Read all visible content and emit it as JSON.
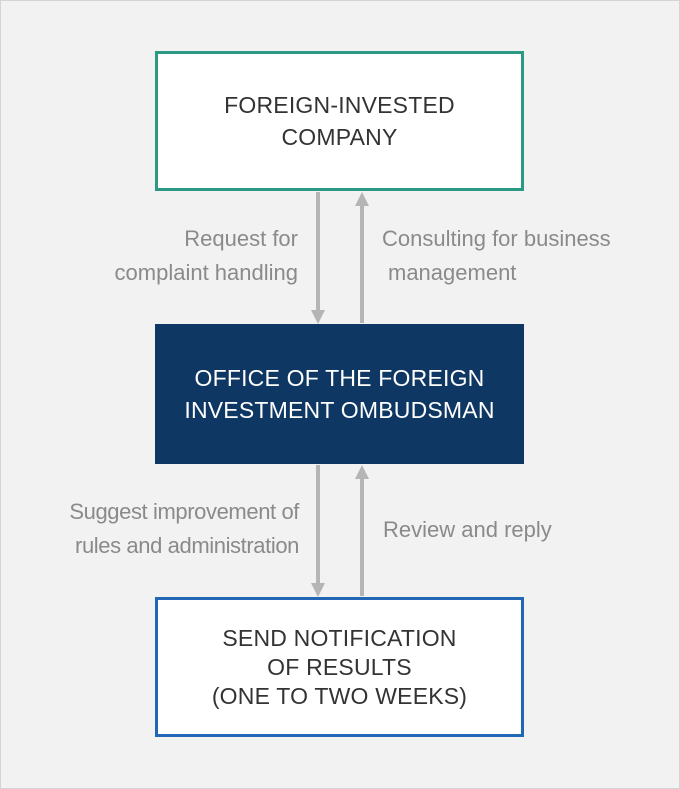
{
  "nodes": {
    "top": {
      "lines": [
        "FOREIGN-INVESTED",
        "COMPANY"
      ]
    },
    "middle": {
      "lines": [
        "OFFICE OF THE FOREIGN",
        "INVESTMENT OMBUDSMAN"
      ]
    },
    "bottom": {
      "lines": [
        "SEND NOTIFICATION",
        "OF RESULTS",
        "(ONE TO TWO WEEKS)"
      ]
    }
  },
  "edges": {
    "request": {
      "lines": [
        "Request for",
        "complaint handling"
      ]
    },
    "consulting": {
      "lines": [
        "Consulting for business",
        "management"
      ]
    },
    "suggest": {
      "lines": [
        "Suggest improvement of",
        "rules and administration"
      ]
    },
    "review": {
      "lines": [
        "Review and reply"
      ]
    }
  },
  "colors": {
    "top_border": "#2a9a82",
    "middle_fill": "#0f3763",
    "bottom_border": "#2267b6",
    "arrow": "#b5b5b5",
    "label_text": "#8a8a8a"
  }
}
